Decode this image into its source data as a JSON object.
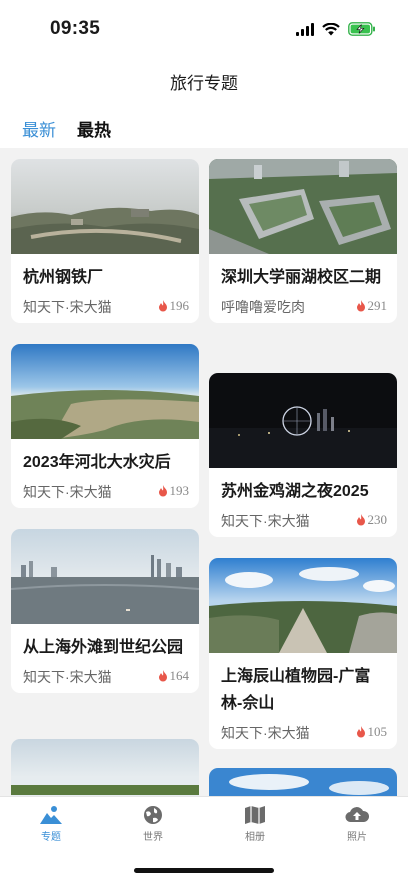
{
  "status": {
    "time": "09:35"
  },
  "nav": {
    "title": "旅行专题"
  },
  "tabs": [
    {
      "label": "最新",
      "active": true
    },
    {
      "label": "最热",
      "active": false
    }
  ],
  "cards": [
    {
      "title": "杭州钢铁厂",
      "author": "知天下·宋大猫",
      "likes": "196",
      "image": "industrial-panorama"
    },
    {
      "title": "深圳大学丽湖校区二期",
      "author": "呼噜噜爱吃肉",
      "likes": "291",
      "image": "campus-aerial"
    },
    {
      "title": "2023年河北大水灾后",
      "author": "知天下·宋大猫",
      "likes": "193",
      "image": "flood-river-panorama"
    },
    {
      "title": "苏州金鸡湖之夜2025",
      "author": "知天下·宋大猫",
      "likes": "230",
      "image": "night-lake-ferris-wheel"
    },
    {
      "title": "从上海外滩到世纪公园",
      "author": "知天下·宋大猫",
      "likes": "164",
      "image": "shanghai-skyline-panorama"
    },
    {
      "title": "上海辰山植物园-广富林-佘山",
      "author": "知天下·宋大猫",
      "likes": "105",
      "image": "botanical-garden-panorama"
    },
    {
      "title": "",
      "author": "",
      "likes": "",
      "image": "field-panorama"
    },
    {
      "title": "",
      "author": "",
      "likes": "",
      "image": "sky-panorama"
    }
  ],
  "tabbar": [
    {
      "label": "专题",
      "icon": "landscape-icon",
      "active": true
    },
    {
      "label": "世界",
      "icon": "globe-icon",
      "active": false
    },
    {
      "label": "相册",
      "icon": "map-icon",
      "active": false
    },
    {
      "label": "照片",
      "icon": "cloud-upload-icon",
      "active": false
    }
  ],
  "colors": {
    "accent": "#3a8fd6",
    "flame": "#e8574a"
  }
}
